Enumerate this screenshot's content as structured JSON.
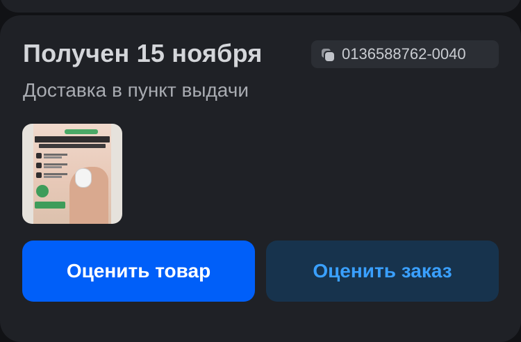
{
  "order": {
    "status_title": "Получен 15 ноября",
    "order_number": "0136588762-0040",
    "order_number_icon": "copy-icon",
    "delivery_type": "Доставка в пункт выдачи",
    "product_image": {
      "description": "product-thumbnail-icon"
    }
  },
  "actions": {
    "rate_product_label": "Оценить товар",
    "rate_order_label": "Оценить заказ"
  },
  "colors": {
    "background": "#111215",
    "card": "#1f2126",
    "primary_button": "#005ff9",
    "secondary_button": "#17334d",
    "secondary_button_text": "#3aa0ff"
  }
}
